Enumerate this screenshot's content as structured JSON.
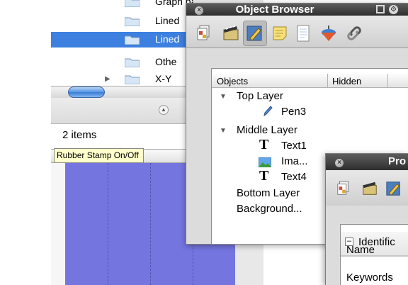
{
  "background_window": {
    "tree_items": [
      {
        "label": "Graph paper",
        "selected": false,
        "disclosure": false
      },
      {
        "label": "Lined",
        "selected": false,
        "disclosure": false
      },
      {
        "label": "Lined",
        "selected": true,
        "disclosure": false
      },
      {
        "label": "Othe",
        "selected": false,
        "disclosure": false
      },
      {
        "label": "X-Y",
        "selected": false,
        "disclosure": true
      }
    ],
    "item_count": "2 items",
    "tooltip": "Rubber Stamp On/Off",
    "colors": {
      "selection": "#3d80df",
      "canvas": "#7575e0"
    }
  },
  "object_browser": {
    "title": "Object Browser",
    "toolbar_icons": [
      "layers-icon",
      "film-clapper-icon",
      "pen-tool-icon",
      "sticky-note-icon",
      "document-icon",
      "spinning-top-icon",
      "link-icon"
    ],
    "selected_tool": "pen-tool-icon",
    "columns": {
      "objects": "Objects",
      "hidden": "Hidden"
    },
    "tree": {
      "top_layer": "Top Layer",
      "pen": "Pen3",
      "middle_layer": "Middle Layer",
      "text1": "Text1",
      "image": "Ima...",
      "text4": "Text4",
      "bottom_layer": "Bottom Layer",
      "background": "Background..."
    }
  },
  "properties": {
    "title": "Pro",
    "section": "Identific",
    "rows": {
      "name": "Name",
      "keywords": "Keywords"
    }
  }
}
